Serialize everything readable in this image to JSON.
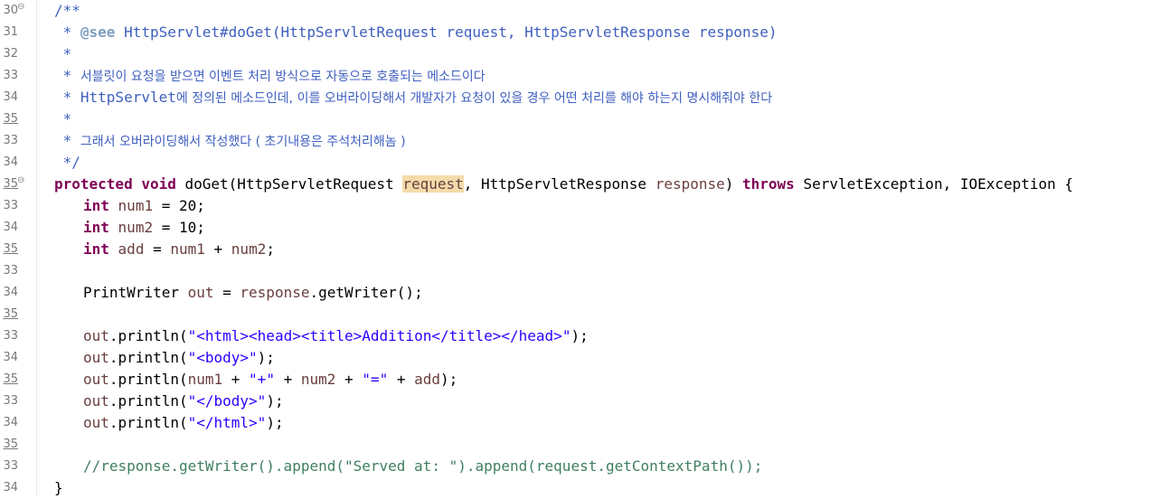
{
  "editor": {
    "lines": [
      {
        "num": "30",
        "fold": "⊖",
        "u": false
      },
      {
        "num": "31",
        "u": false
      },
      {
        "num": "32",
        "u": false
      },
      {
        "num": "33",
        "u": false
      },
      {
        "num": "34",
        "u": false
      },
      {
        "num": "35",
        "u": true
      },
      {
        "num": "33",
        "u": false
      },
      {
        "num": "34",
        "u": false
      },
      {
        "num": "35",
        "fold": "⊖",
        "u": true
      },
      {
        "num": "33",
        "u": false
      },
      {
        "num": "34",
        "u": false
      },
      {
        "num": "35",
        "u": true
      },
      {
        "num": "33",
        "u": false
      },
      {
        "num": "34",
        "u": false
      },
      {
        "num": "35",
        "u": true
      },
      {
        "num": "33",
        "u": false
      },
      {
        "num": "34",
        "u": false
      },
      {
        "num": "35",
        "u": true
      },
      {
        "num": "33",
        "u": false
      },
      {
        "num": "34",
        "u": false
      },
      {
        "num": "35",
        "u": true
      },
      {
        "num": "33",
        "u": false
      },
      {
        "num": "34",
        "u": false
      }
    ],
    "code": {
      "l0_a": "/**",
      "l1_a": " * ",
      "l1_tag": "@see",
      "l1_b": " HttpServlet#doGet(HttpServletRequest request, HttpServletResponse response)",
      "l2_a": " *",
      "l3_a": " * ",
      "l3_kor": "서블릿이 요청을 받으면 이벤트 처리 방식으로 자동으로 호출되는 메소드이다",
      "l4_a": " * HttpServlet",
      "l4_kor": "에 정의된 메소드인데, 이를 오버라이딩해서 개발자가 요청이 있을 경우 어떤 처리를 해야 하는지 명시해줘야 한다",
      "l5_a": " *",
      "l6_a": " * ",
      "l6_kor": "그래서 오버라이딩해서 작성했다 ( 초기내용은 주석처리해놈 )",
      "l7_a": " */",
      "l8_kw1": "protected",
      "l8_kw2": "void",
      "l8_a": " doGet(HttpServletRequest ",
      "l8_req": "request",
      "l8_b": ", HttpServletResponse ",
      "l8_resp": "response",
      "l8_c": ") ",
      "l8_kw3": "throws",
      "l8_d": " ServletException, IOException {",
      "l9_kw": "int",
      "l9_var": "num1",
      "l9_a": " = 20;",
      "l10_kw": "int",
      "l10_var": "num2",
      "l10_a": " = 10;",
      "l11_kw": "int",
      "l11_var": "add",
      "l11_a": " = ",
      "l11_v1": "num1",
      "l11_b": " + ",
      "l11_v2": "num2",
      "l11_c": ";",
      "l13_a": "PrintWriter ",
      "l13_var": "out",
      "l13_b": " = ",
      "l13_v2": "response",
      "l13_c": ".getWriter();",
      "l15_var": "out",
      "l15_a": ".println(",
      "l15_str": "\"<html><head><title>Addition</title></head>\"",
      "l15_b": ");",
      "l16_var": "out",
      "l16_a": ".println(",
      "l16_str": "\"<body>\"",
      "l16_b": ");",
      "l17_var": "out",
      "l17_a": ".println(",
      "l17_v1": "num1",
      "l17_b": " + ",
      "l17_s1": "\"+\"",
      "l17_c": " + ",
      "l17_v2": "num2",
      "l17_d": " + ",
      "l17_s2": "\"=\"",
      "l17_e": " + ",
      "l17_v3": "add",
      "l17_f": ");",
      "l18_var": "out",
      "l18_a": ".println(",
      "l18_str": "\"</body>\"",
      "l18_b": ");",
      "l19_var": "out",
      "l19_a": ".println(",
      "l19_str": "\"</html>\"",
      "l19_b": ");",
      "l21_cm": "//response.getWriter().append(\"Served at: \").append(request.getContextPath());",
      "l22_a": "}"
    },
    "colors": {
      "javadoc": "#3f5fbf",
      "keyword": "#7f0055",
      "variable": "#6a3e3e",
      "string": "#2a00ff",
      "comment": "#3f7f5f",
      "highlight": "#f4dcaa"
    }
  }
}
